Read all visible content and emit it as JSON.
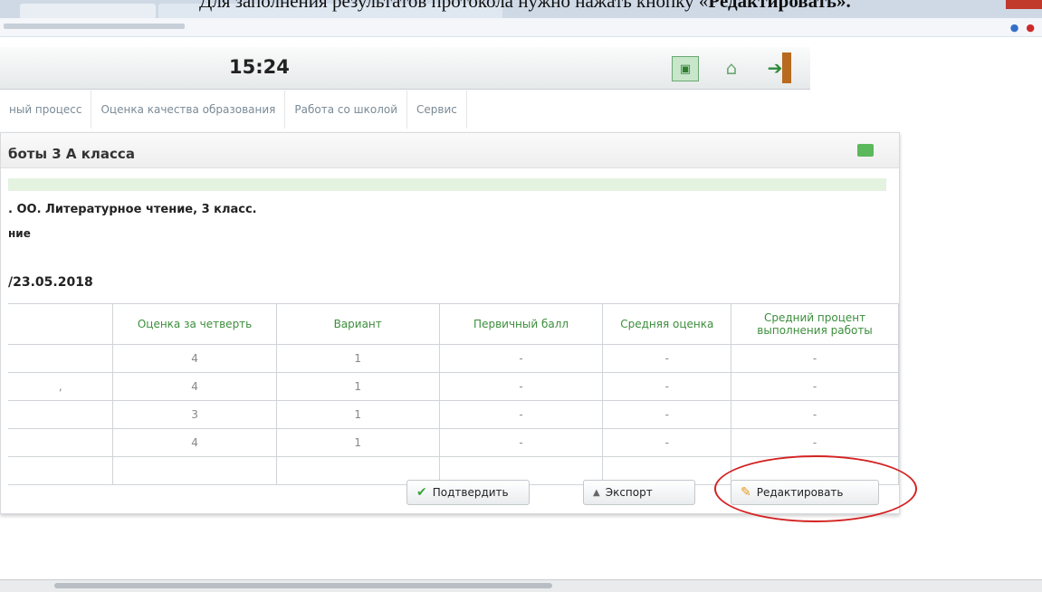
{
  "caption": {
    "prefix": "Для заполнения результатов протокола нужно нажать кнопку «",
    "bold": "Редактировать»."
  },
  "header": {
    "time": "15:24"
  },
  "nav_tabs": [
    {
      "label": "ный процесс"
    },
    {
      "label": "Оценка качества образования"
    },
    {
      "label": "Работа со школой"
    },
    {
      "label": "Сервис"
    }
  ],
  "panel": {
    "title": "боты 3 А класса",
    "line1": ". ОО. Литературное чтение, 3 класс.",
    "line2": "ние",
    "line3": "/23.05.2018"
  },
  "table": {
    "headers": [
      "",
      "Оценка за четверть",
      "Вариант",
      "Первичный балл",
      "Средняя оценка",
      "Средний процент выполнения работы"
    ],
    "rows": [
      [
        "",
        "4",
        "1",
        "-",
        "-",
        "-"
      ],
      [
        ",",
        "4",
        "1",
        "-",
        "-",
        "-"
      ],
      [
        "",
        "3",
        "1",
        "-",
        "-",
        "-"
      ],
      [
        "",
        "4",
        "1",
        "-",
        "-",
        "-"
      ],
      [
        "",
        "",
        "",
        "",
        "",
        ""
      ]
    ]
  },
  "buttons": {
    "confirm": "Подтвердить",
    "export": "Экспорт",
    "edit": "Редактировать"
  },
  "colors": {
    "accent_green": "#3c8e3c",
    "annotation_red": "#d42222"
  }
}
